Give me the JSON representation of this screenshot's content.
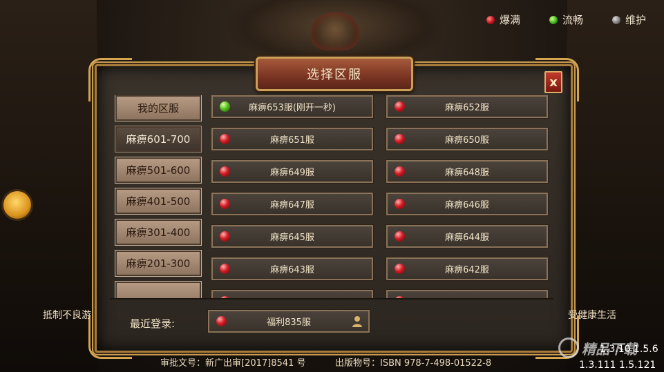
{
  "legend": [
    {
      "label": "爆满",
      "color": "red"
    },
    {
      "label": "流畅",
      "color": "green"
    },
    {
      "label": "维护",
      "color": "gray"
    }
  ],
  "title": "选择区服",
  "close_label": "x",
  "categories": [
    {
      "label": "我的区服",
      "active": false
    },
    {
      "label": "麻痹601-700",
      "active": true
    },
    {
      "label": "麻痹501-600",
      "active": false
    },
    {
      "label": "麻痹401-500",
      "active": false
    },
    {
      "label": "麻痹301-400",
      "active": false
    },
    {
      "label": "麻痹201-300",
      "active": false
    }
  ],
  "servers": [
    {
      "label": "麻痹653服(刚开一秒)",
      "status": "green"
    },
    {
      "label": "麻痹652服",
      "status": "red"
    },
    {
      "label": "麻痹651服",
      "status": "red"
    },
    {
      "label": "麻痹650服",
      "status": "red"
    },
    {
      "label": "麻痹649服",
      "status": "red"
    },
    {
      "label": "麻痹648服",
      "status": "red"
    },
    {
      "label": "麻痹647服",
      "status": "red"
    },
    {
      "label": "麻痹646服",
      "status": "red"
    },
    {
      "label": "麻痹645服",
      "status": "red"
    },
    {
      "label": "麻痹644服",
      "status": "red"
    },
    {
      "label": "麻痹643服",
      "status": "red"
    },
    {
      "label": "麻痹642服",
      "status": "red"
    }
  ],
  "recent": {
    "label": "最近登录:",
    "server": "福利835服",
    "status": "red",
    "icon": "user-icon"
  },
  "side_left": "抵制不良游",
  "side_right": "受健康生活",
  "footer": {
    "approval": "审批文号：新广出审[2017]8541 号",
    "isbn": "出版物号：ISBN 978-7-498-01522-8"
  },
  "version": {
    "line1": "1.3.10  1.5.6",
    "line2": "1.3.111  1.5.121"
  },
  "watermark": "精品下载"
}
